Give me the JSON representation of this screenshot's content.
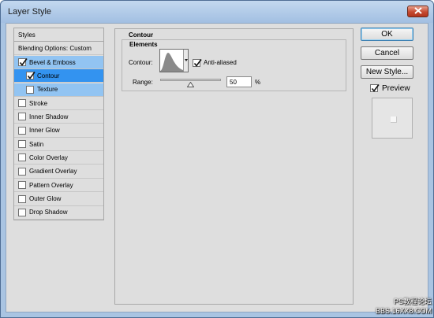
{
  "window": {
    "title": "Layer Style"
  },
  "styles_panel": {
    "header": "Styles",
    "blending_options": "Blending Options: Custom",
    "items": [
      {
        "label": "Bevel & Emboss",
        "checked": true,
        "state": "parent-selected",
        "indent": 0
      },
      {
        "label": "Contour",
        "checked": true,
        "state": "selected",
        "indent": 1
      },
      {
        "label": "Texture",
        "checked": false,
        "state": "parent-selected",
        "indent": 1
      },
      {
        "label": "Stroke",
        "checked": false,
        "state": "normal",
        "indent": 0
      },
      {
        "label": "Inner Shadow",
        "checked": false,
        "state": "normal",
        "indent": 0
      },
      {
        "label": "Inner Glow",
        "checked": false,
        "state": "normal",
        "indent": 0
      },
      {
        "label": "Satin",
        "checked": false,
        "state": "normal",
        "indent": 0
      },
      {
        "label": "Color Overlay",
        "checked": false,
        "state": "normal",
        "indent": 0
      },
      {
        "label": "Gradient Overlay",
        "checked": false,
        "state": "normal",
        "indent": 0
      },
      {
        "label": "Pattern Overlay",
        "checked": false,
        "state": "normal",
        "indent": 0
      },
      {
        "label": "Outer Glow",
        "checked": false,
        "state": "normal",
        "indent": 0
      },
      {
        "label": "Drop Shadow",
        "checked": false,
        "state": "normal",
        "indent": 0
      }
    ]
  },
  "contour_section": {
    "title": "Contour",
    "elements_title": "Elements",
    "contour_label": "Contour:",
    "anti_aliased_label": "Anti-aliased",
    "anti_aliased_checked": true,
    "range_label": "Range:",
    "range_value": "50",
    "range_unit": "%",
    "range_percent": 50
  },
  "buttons": {
    "ok": "OK",
    "cancel": "Cancel",
    "new_style": "New Style...",
    "preview_label": "Preview",
    "preview_checked": true
  },
  "watermark": {
    "line1": "PS教程论坛",
    "line2": "BBS.16XX8.COM"
  },
  "colors": {
    "selected_row": "#3393f0",
    "parent_selected_row": "#92c4f2",
    "panel_bg": "#dedede",
    "titlebar": "#a9c4e2",
    "close_button": "#c54a31"
  },
  "icons": {
    "close": "close-x-icon",
    "checkmark": "checkmark-icon",
    "contour_curve": "contour-curve-icon",
    "dropdown_arrow": "dropdown-arrow-icon",
    "slider_thumb": "triangle-slider-icon"
  }
}
